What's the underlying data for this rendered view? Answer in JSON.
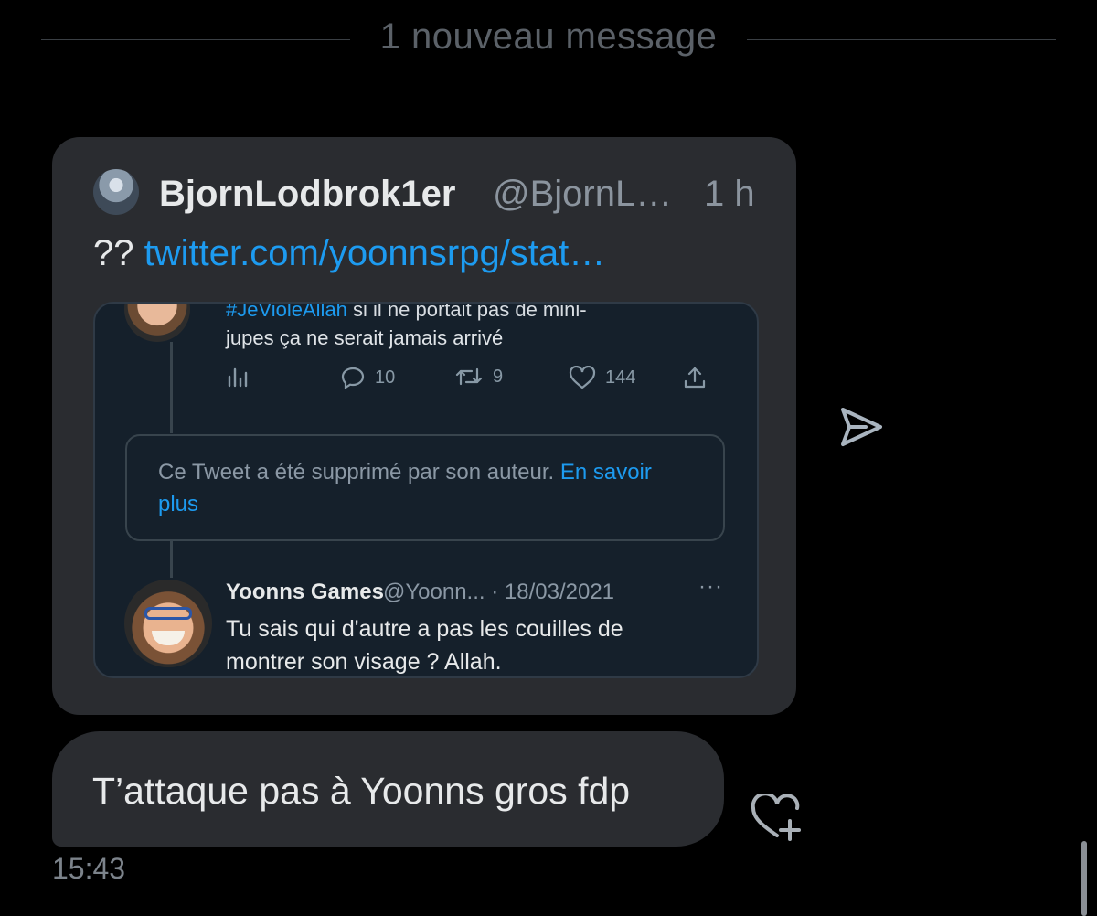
{
  "divider": {
    "label": "1 nouveau message"
  },
  "shared_tweet": {
    "author_name": "BjornLodbrok1er",
    "author_handle": "@BjornL…",
    "time": "1 h",
    "text_prefix": "??",
    "link_text": "twitter.com/yoonnsrpg/stat…",
    "embedded": {
      "top_tweet": {
        "hashtag": "#JeVioleAllah",
        "line1_rest": " si il ne portait pas de mini-",
        "line2": "jupes ça ne serait jamais arrivé",
        "replies": "10",
        "retweets": "9",
        "likes": "144"
      },
      "deleted_notice": {
        "text": "Ce Tweet a été supprimé par son auteur.",
        "link": "En savoir plus"
      },
      "reply_tweet": {
        "name": "Yoonns Games",
        "meta": "@Yoonn... · 18/03/2021",
        "more": "···",
        "text": "Tu sais qui d'autre a pas les couilles de montrer son visage ? Allah."
      }
    }
  },
  "message": {
    "text": "T’attaque pas à Yoonns gros fdp",
    "timestamp": "15:43"
  },
  "colors": {
    "background": "#000000",
    "bubble": "#2a2c30",
    "link": "#1d9bf0",
    "embed_bg": "#15202b"
  },
  "icons": [
    "share-icon",
    "add-reaction-heart-icon",
    "analytics-icon",
    "reply-icon",
    "retweet-icon",
    "like-icon",
    "upload-icon"
  ]
}
